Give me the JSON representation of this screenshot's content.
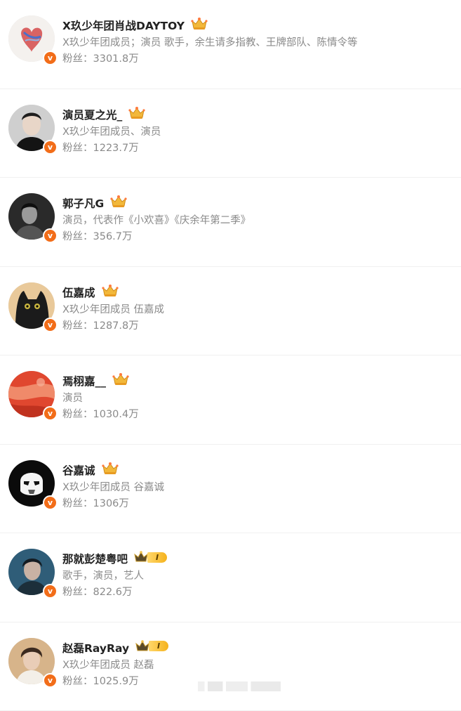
{
  "colors": {
    "verified": "#f26d19",
    "name": "#222222",
    "meta": "#8a8a8a"
  },
  "users": [
    {
      "name": "X玖少年团肖战DAYTOY",
      "desc": "X玖少年团成员；演员 歌手，余生请多指教、王牌部队、陈情令等",
      "fans": "粉丝：3301.8万",
      "badge_icon": "crown-icon",
      "badge_level": "",
      "avatar": "heart-art"
    },
    {
      "name": "演员夏之光_",
      "desc": "X玖少年团成员、演员",
      "fans": "粉丝：1223.7万",
      "badge_icon": "crown-icon",
      "badge_level": "",
      "avatar": "portrait-dark"
    },
    {
      "name": "郭子凡G",
      "desc": "演员，代表作《小欢喜》《庆余年第二季》",
      "fans": "粉丝：356.7万",
      "badge_icon": "crown-icon",
      "badge_level": "",
      "avatar": "portrait-bw"
    },
    {
      "name": "伍嘉成",
      "desc": "X玖少年团成员 伍嘉成",
      "fans": "粉丝：1287.8万",
      "badge_icon": "crown-icon",
      "badge_level": "",
      "avatar": "black-cat"
    },
    {
      "name": "焉栩嘉__",
      "desc": "演员",
      "fans": "粉丝：1030.4万",
      "badge_icon": "crown-icon",
      "badge_level": "",
      "avatar": "red-painting"
    },
    {
      "name": "谷嘉诚",
      "desc": "X玖少年团成员 谷嘉诚",
      "fans": "粉丝：1306万",
      "badge_icon": "crown-icon",
      "badge_level": "",
      "avatar": "stormtrooper"
    },
    {
      "name": "那就彭楚粤吧",
      "desc": "歌手，演员，艺人",
      "fans": "粉丝：822.6万",
      "badge_icon": "crown-level-icon",
      "badge_level": "I",
      "avatar": "portrait-blue"
    },
    {
      "name": "赵磊RayRay",
      "desc": "X玖少年团成员 赵磊",
      "fans": "粉丝：1025.9万",
      "badge_icon": "crown-level-icon",
      "badge_level": "I",
      "avatar": "portrait-warm"
    }
  ]
}
